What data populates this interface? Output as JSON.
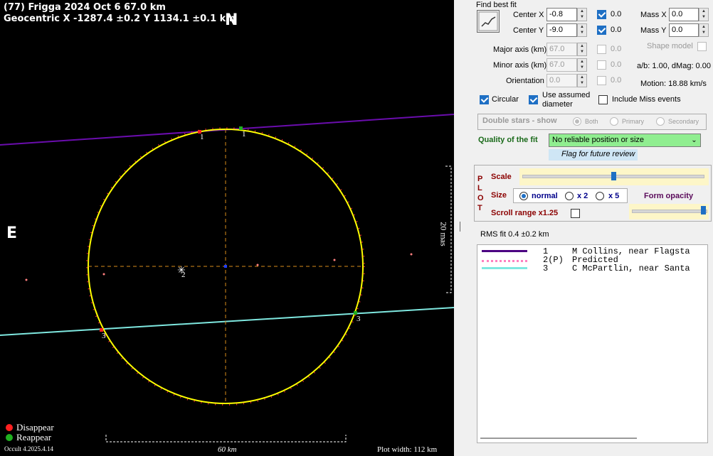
{
  "plot": {
    "title_line1": "(77) Frigga  2024 Oct 6   67.0 km",
    "title_line2": "Geocentric  X  -1287.4 ±0.2  Y 1134.1 ±0.1 km",
    "compass_n": "N",
    "compass_e": "E",
    "legend_disappear": "Disappear",
    "legend_reappear": "Reappear",
    "version": "Occult 4.2025.4.14",
    "scale_label": "60 km",
    "plot_width": "Plot width: 112 km",
    "mas_label": "20 mas",
    "chord_labels": [
      "1",
      "1",
      "2",
      "3",
      "3"
    ],
    "colors": {
      "ellipse": "#ffff00",
      "chord1": "#6a0dad",
      "chord3": "#7fe8e0",
      "crosshair": "#d98c1a",
      "disappear": "#ff2020",
      "reappear": "#20b020",
      "predicted": "#ff80c0"
    }
  },
  "panel": {
    "find_best_fit": "Find best fit",
    "fit_icon": "chart-fit-icon",
    "center_x_label": "Center X",
    "center_x_value": "-0.8",
    "center_x_check": "0.0",
    "center_y_label": "Center Y",
    "center_y_value": "-9.0",
    "center_y_check": "0.0",
    "mass_x_label": "Mass X",
    "mass_x_value": "0.0",
    "mass_y_label": "Mass Y",
    "mass_y_value": "0.0",
    "shape_model": "Shape model",
    "major_axis_label": "Major axis (km)",
    "major_axis_value": "67.0",
    "major_axis_check": "0.0",
    "minor_axis_label": "Minor axis (km)",
    "minor_axis_value": "67.0",
    "minor_axis_check": "0.0",
    "orientation_label": "Orientation",
    "orientation_value": "0.0",
    "orientation_check": "0.0",
    "ab_dmag": "a/b: 1.00, dMag: 0.00",
    "motion": "Motion: 18.88 km/s",
    "circular": "Circular",
    "use_assumed": "Use assumed diameter",
    "include_miss": "Include Miss events",
    "double_stars": "Double stars - show",
    "ds_both": "Both",
    "ds_primary": "Primary",
    "ds_secondary": "Secondary",
    "quality_label": "Quality of the fit",
    "quality_value": "No reliable position or size",
    "flag_review": "Flag for future review",
    "plot_letters": [
      "P",
      "L",
      "O",
      "T"
    ],
    "scale_label": "Scale",
    "size_label": "Size",
    "size_normal": "normal",
    "size_x2": "x 2",
    "size_x5": "x 5",
    "form_opacity": "Form opacity",
    "scroll_range": "Scroll range x1.25",
    "rms_fit": "RMS fit 0.4 ±0.2 km",
    "legend_rows": [
      {
        "num": "1",
        "text": "M Collins, near Flagsta"
      },
      {
        "num": "2(P)",
        "text": "Predicted"
      },
      {
        "num": "3",
        "text": "C McPartlin, near Santa"
      }
    ]
  }
}
